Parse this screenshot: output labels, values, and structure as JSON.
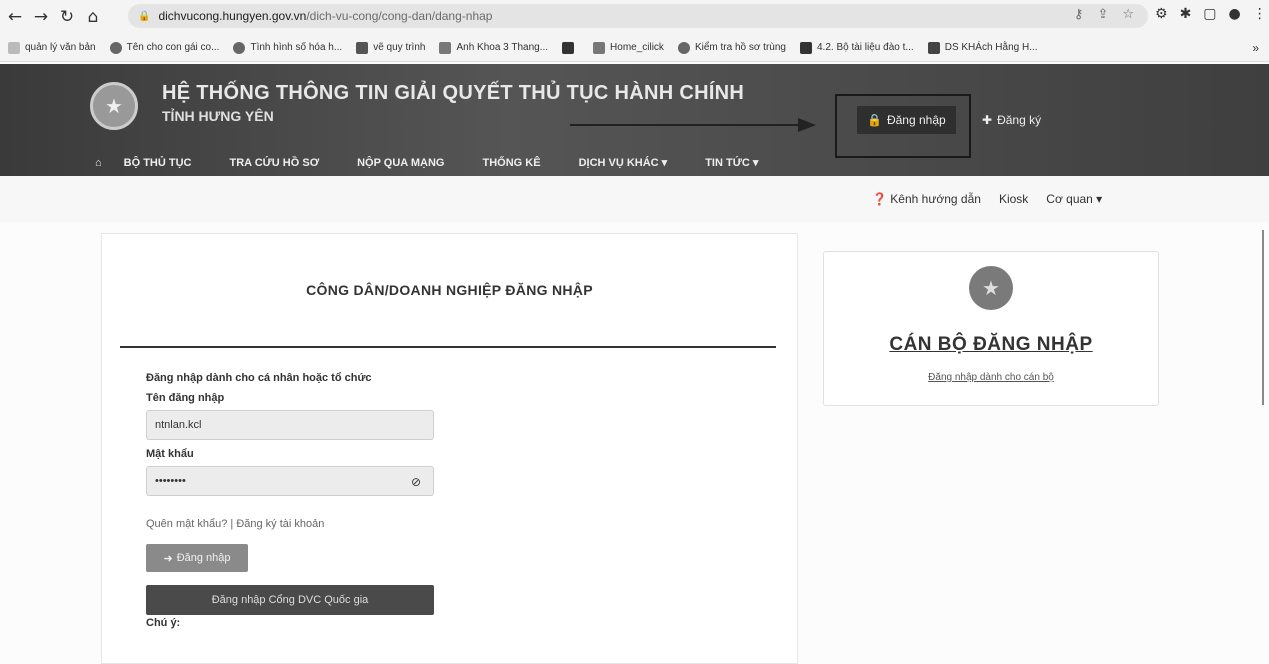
{
  "browser": {
    "url_host": "dichvucong.hungyen.gov.vn",
    "url_path": "/dich-vu-cong/cong-dan/dang-nhap",
    "bookmarks": [
      {
        "label": "quản lý văn bản"
      },
      {
        "label": "Tên cho con gái co..."
      },
      {
        "label": "Tình hình số hóa h..."
      },
      {
        "label": "vẽ quy trình"
      },
      {
        "label": "Anh Khoa 3 Thang..."
      },
      {
        "label": ""
      },
      {
        "label": "Home_cilick"
      },
      {
        "label": "Kiểm tra hồ sơ trùng"
      },
      {
        "label": "4.2. Bộ tài liệu đào t..."
      },
      {
        "label": "DS KHÁch Hằng H..."
      }
    ],
    "more": "»"
  },
  "header": {
    "title": "HỆ THỐNG THÔNG TIN GIẢI QUYẾT THỦ TỤC HÀNH CHÍNH",
    "subtitle": "TỈNH HƯNG YÊN",
    "login_label": "Đăng nhập",
    "register_label": "Đăng ký"
  },
  "nav": {
    "items": [
      {
        "label": "BỘ THỦ TỤC"
      },
      {
        "label": "TRA CỨU HỒ SƠ"
      },
      {
        "label": "NỘP QUA MẠNG"
      },
      {
        "label": "THỐNG KÊ"
      },
      {
        "label": "DỊCH VỤ KHÁC ▾"
      },
      {
        "label": "TIN TỨC ▾"
      }
    ]
  },
  "subbar": {
    "guide": "Kênh hướng dẫn",
    "kiosk": "Kiosk",
    "agency": "Cơ quan ▾"
  },
  "login_form": {
    "title": "CÔNG DÂN/DOANH NGHIỆP ĐĂNG NHẬP",
    "description": "Đăng nhập dành cho cá nhân hoặc tổ chức",
    "username_label": "Tên đăng nhập",
    "username_value": "ntnlan.kcl",
    "password_label": "Mật khẩu",
    "password_value": "••••••••",
    "forgot": "Quên mật khẩu?",
    "separator": "|",
    "register_account": "Đăng ký tài khoản",
    "login_button": "Đăng nhập",
    "national_button": "Đăng nhập Cổng DVC Quốc gia",
    "note": "Chú ý:"
  },
  "official": {
    "title": "CÁN BỘ ĐĂNG NHẬP",
    "subtitle": "Đăng nhập dành cho cán bộ"
  }
}
